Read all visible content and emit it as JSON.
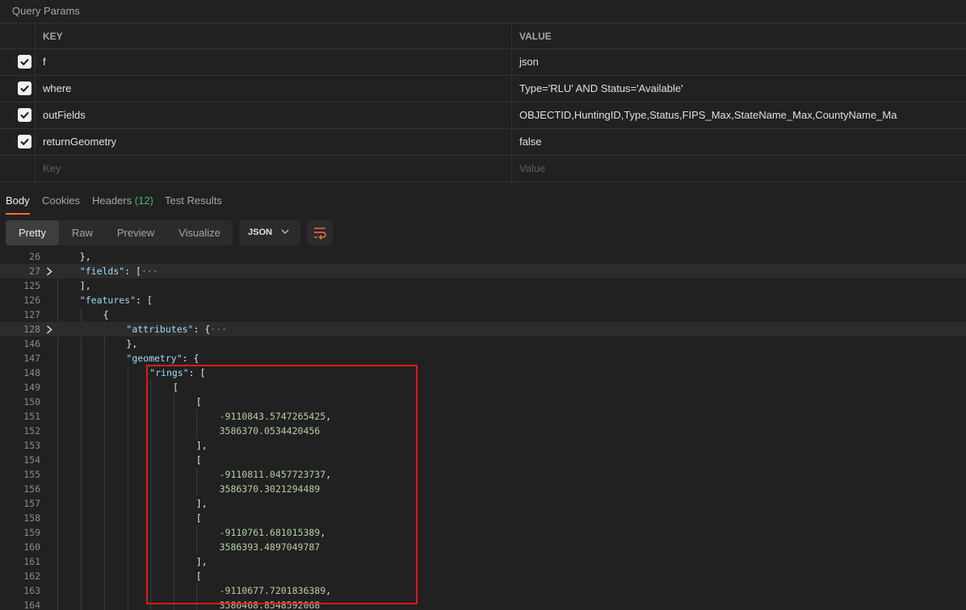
{
  "query_params": {
    "title": "Query Params",
    "headers": {
      "key": "KEY",
      "value": "VALUE"
    },
    "rows": [
      {
        "key": "f",
        "value": "json",
        "checked": true
      },
      {
        "key": "where",
        "value": "Type='RLU' AND Status='Available'",
        "checked": true
      },
      {
        "key": "outFields",
        "value": "OBJECTID,HuntingID,Type,Status,FIPS_Max,StateName_Max,CountyName_Ma",
        "checked": true
      },
      {
        "key": "returnGeometry",
        "value": "false",
        "checked": true
      }
    ],
    "placeholder": {
      "key": "Key",
      "value": "Value"
    }
  },
  "response_tabs": {
    "body": "Body",
    "cookies": "Cookies",
    "headers": "Headers",
    "headers_count": "(12)",
    "test_results": "Test Results"
  },
  "view_modes": [
    "Pretty",
    "Raw",
    "Preview",
    "Visualize"
  ],
  "format": "JSON",
  "code_lines": [
    {
      "no": "26",
      "text": "},",
      "indent": 2
    },
    {
      "no": "27",
      "key": "\"fields\"",
      "text": ": [",
      "ellipsis": "···",
      "indent": 2,
      "fold": true,
      "highlight": true
    },
    {
      "no": "125",
      "text": "],",
      "indent": 2
    },
    {
      "no": "126",
      "key": "\"features\"",
      "text": ": [",
      "indent": 2
    },
    {
      "no": "127",
      "text": "{",
      "indent": 3
    },
    {
      "no": "128",
      "key": "\"attributes\"",
      "text": ": {",
      "ellipsis": "···",
      "indent": 4,
      "fold": true,
      "highlight": true
    },
    {
      "no": "146",
      "text": "},",
      "indent": 4
    },
    {
      "no": "147",
      "key": "\"geometry\"",
      "text": ": {",
      "indent": 4
    },
    {
      "no": "148",
      "key": "\"rings\"",
      "text": ": [",
      "indent": 5
    },
    {
      "no": "149",
      "text": "[",
      "indent": 6
    },
    {
      "no": "150",
      "text": "[",
      "indent": 7
    },
    {
      "no": "151",
      "num": "-9110843.5747265425",
      "text": ",",
      "indent": 8
    },
    {
      "no": "152",
      "num": "3586370.0534420456",
      "text": "",
      "indent": 8
    },
    {
      "no": "153",
      "text": "],",
      "indent": 7
    },
    {
      "no": "154",
      "text": "[",
      "indent": 7
    },
    {
      "no": "155",
      "num": "-9110811.0457723737",
      "text": ",",
      "indent": 8
    },
    {
      "no": "156",
      "num": "3586370.3021294489",
      "text": "",
      "indent": 8
    },
    {
      "no": "157",
      "text": "],",
      "indent": 7
    },
    {
      "no": "158",
      "text": "[",
      "indent": 7
    },
    {
      "no": "159",
      "num": "-9110761.681015389",
      "text": ",",
      "indent": 8
    },
    {
      "no": "160",
      "num": "3586393.4897049787",
      "text": "",
      "indent": 8
    },
    {
      "no": "161",
      "text": "],",
      "indent": 7
    },
    {
      "no": "162",
      "text": "[",
      "indent": 7
    },
    {
      "no": "163",
      "num": "-9110677.7201836389",
      "text": ",",
      "indent": 8
    },
    {
      "no": "164",
      "num": "3586468.8548592068",
      "text": "",
      "indent": 8
    }
  ],
  "colors": {
    "background": "#212121",
    "accent_tab": "#ff6c37",
    "headers_count": "#4cb96d",
    "json_key": "#9cdcfe",
    "json_number": "#b5cea8",
    "annotation_box": "#e0191c"
  }
}
